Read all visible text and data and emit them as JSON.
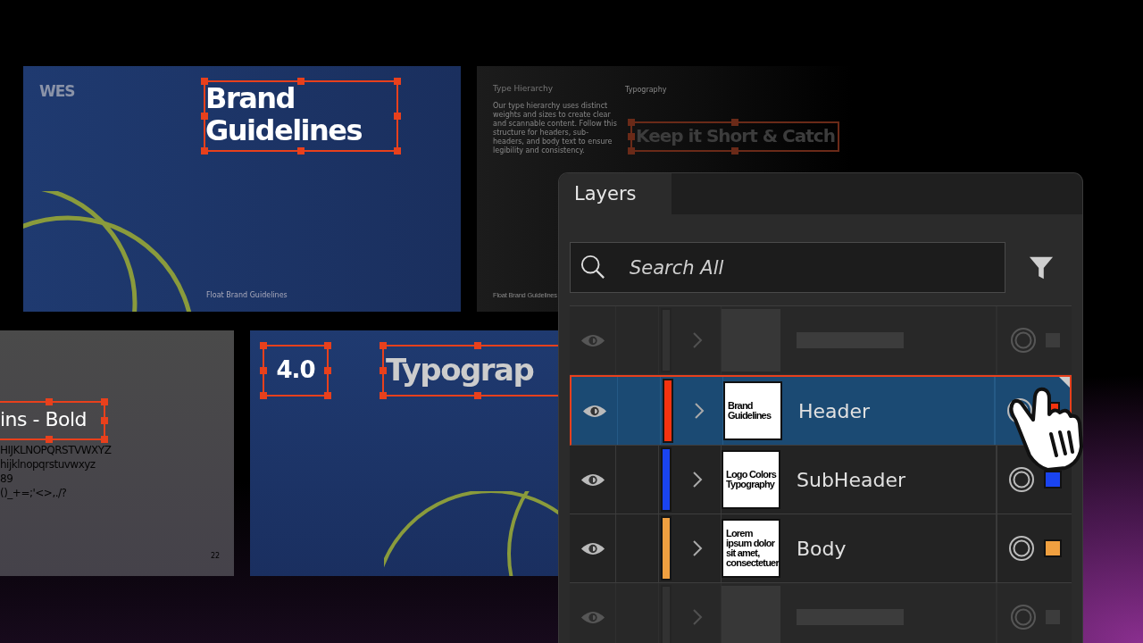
{
  "cover_slide": {
    "logo": "WES",
    "title": "Brand Guidelines",
    "footer": "Float Brand Guidelines"
  },
  "hierarchy_slide": {
    "heading": "Type Hierarchy",
    "body": "Our type hierarchy uses distinct weights and sizes to create clear and scannable content. Follow this structure for headers, sub-headers, and body text to ensure legibility and consistency.",
    "label": "Typography",
    "title": "Keep it Short & Catch",
    "footer": "Float Brand Guidelines"
  },
  "font_slide": {
    "title": "ins - Bold",
    "samples": [
      "HIJKLNOPQRSTVWXYZ",
      "hijklnopqrstuvwxyz",
      "89",
      "()_+=;'<>,./?"
    ],
    "page": "22"
  },
  "section_slide": {
    "number": "4.0",
    "title": "Typograp"
  },
  "layers_panel": {
    "tab": "Layers",
    "search": {
      "placeholder": "Search All"
    },
    "rows": [
      {
        "kind": "placeholder",
        "selected": false
      },
      {
        "kind": "layer",
        "name": "Header",
        "thumbnail": "Brand Guidelines",
        "color": "#f4330f",
        "selected": true
      },
      {
        "kind": "layer",
        "name": "SubHeader",
        "thumbnail": "Logo Colors Typography",
        "color": "#1a44f0",
        "selected": false
      },
      {
        "kind": "layer",
        "name": "Body",
        "thumbnail": "Lorem ipsum dolor sit amet, consectetuer",
        "color": "#f0a040",
        "selected": false
      },
      {
        "kind": "placeholder",
        "selected": false
      }
    ]
  }
}
